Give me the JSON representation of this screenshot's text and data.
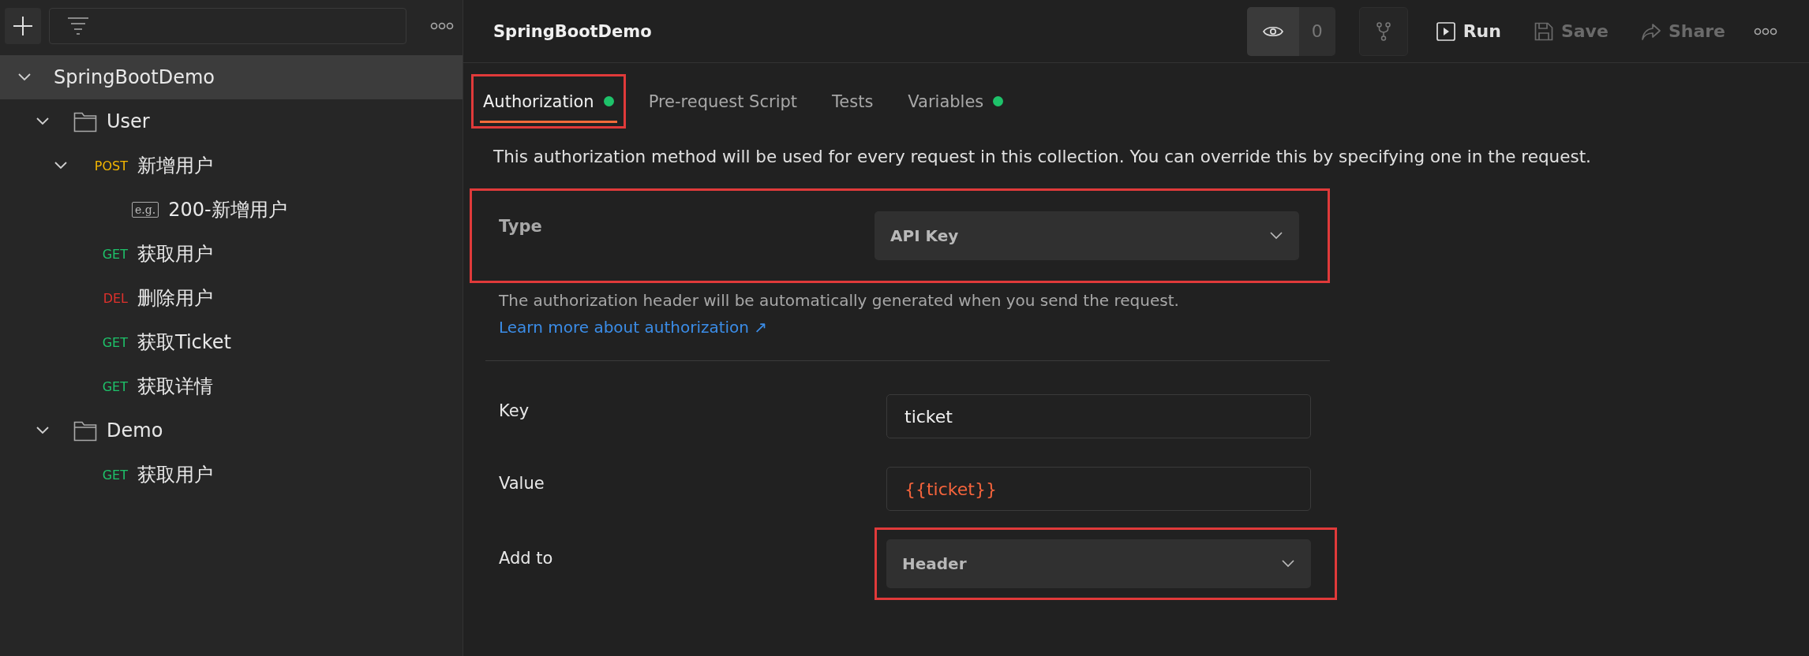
{
  "sidebar": {
    "collection": {
      "name": "SpringBootDemo",
      "expanded": true,
      "selected": true,
      "children": [
        {
          "kind": "folder",
          "name": "User",
          "expanded": true,
          "children": [
            {
              "kind": "request",
              "method": "POST",
              "name": "新增用户",
              "expanded": true,
              "children": [
                {
                  "kind": "example",
                  "badge": "e.g.",
                  "name": "200-新增用户"
                }
              ]
            },
            {
              "kind": "request",
              "method": "GET",
              "name": "获取用户"
            },
            {
              "kind": "request",
              "method": "DEL",
              "name": "删除用户"
            },
            {
              "kind": "request",
              "method": "GET",
              "name": "获取Ticket"
            },
            {
              "kind": "request",
              "method": "GET",
              "name": "获取详情"
            }
          ]
        },
        {
          "kind": "folder",
          "name": "Demo",
          "expanded": true,
          "children": [
            {
              "kind": "request",
              "method": "GET",
              "name": "获取用户"
            }
          ]
        }
      ]
    }
  },
  "header": {
    "title": "SpringBootDemo",
    "watch_count": "0",
    "actions": [
      {
        "kind": "run",
        "label": "Run",
        "disabled": false
      },
      {
        "kind": "save",
        "label": "Save",
        "disabled": true
      },
      {
        "kind": "share",
        "label": "Share",
        "disabled": true
      }
    ]
  },
  "tabs": [
    {
      "label": "Authorization",
      "selected": true,
      "dot": true,
      "highlighted": true
    },
    {
      "label": "Pre-request Script",
      "selected": false,
      "dot": false,
      "highlighted": false
    },
    {
      "label": "Tests",
      "selected": false,
      "dot": false,
      "highlighted": false
    },
    {
      "label": "Variables",
      "selected": false,
      "dot": true,
      "highlighted": false
    }
  ],
  "description": "This authorization method will be used for every request in this collection. You can override this by specifying one in the request.",
  "type_row": {
    "label": "Type",
    "value": "API Key",
    "highlighted": true
  },
  "help": {
    "text": "The authorization header will be automatically generated when you send the request.",
    "link": "Learn more about authorization ↗"
  },
  "fields": [
    {
      "kind": "input",
      "label": "Key",
      "value": "ticket",
      "variable": false,
      "highlighted": false
    },
    {
      "kind": "input",
      "label": "Value",
      "value": "{{ticket}}",
      "variable": true,
      "highlighted": false
    },
    {
      "kind": "select",
      "label": "Add to",
      "value": "Header",
      "variable": false,
      "highlighted": true
    }
  ]
}
